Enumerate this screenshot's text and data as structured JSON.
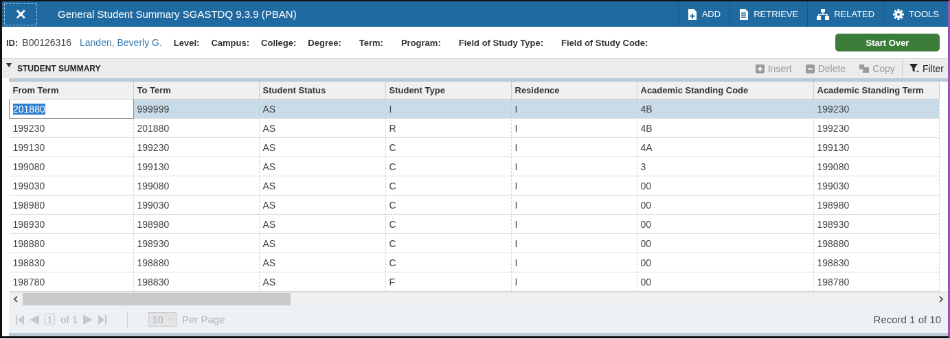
{
  "window": {
    "close": "✕",
    "title": "General Student Summary SGASTDQ 9.3.9 (PBAN)"
  },
  "toolbar": [
    {
      "label": "ADD",
      "kind": "add"
    },
    {
      "label": "RETRIEVE",
      "kind": "retrieve"
    },
    {
      "label": "RELATED",
      "kind": "related"
    },
    {
      "label": "TOOLS",
      "kind": "tools"
    }
  ],
  "key_block": {
    "id_label": "ID:",
    "id": "B00126316",
    "name": "Landen, Beverly G.",
    "fields": [
      "Level:",
      "Campus:",
      "College:",
      "Degree:",
      "Term:",
      "Program:",
      "Field of Study Type:",
      "Field of Study Code:"
    ],
    "start_over": "Start Over"
  },
  "section": {
    "title": "STUDENT SUMMARY",
    "expanded": true,
    "actions": [
      {
        "label": "Insert",
        "kind": "insert",
        "disabled": true
      },
      {
        "label": "Delete",
        "kind": "delete",
        "disabled": true
      },
      {
        "label": "Copy",
        "kind": "copy",
        "disabled": true
      },
      {
        "label": "Filter",
        "kind": "filter",
        "disabled": false
      }
    ]
  },
  "table": {
    "columns": [
      "From Term",
      "To Term",
      "Student Status",
      "Student Type",
      "Residence",
      "Academic Standing Code",
      "Academic Standing Term"
    ],
    "rows": [
      {
        "selected": true,
        "cells": [
          "201880",
          "999999",
          "AS",
          "I",
          "I",
          "4B",
          "199230"
        ]
      },
      {
        "selected": false,
        "cells": [
          "199230",
          "201880",
          "AS",
          "R",
          "I",
          "4B",
          "199230"
        ]
      },
      {
        "selected": false,
        "cells": [
          "199130",
          "199230",
          "AS",
          "C",
          "I",
          "4A",
          "199130"
        ]
      },
      {
        "selected": false,
        "cells": [
          "199080",
          "199130",
          "AS",
          "C",
          "I",
          "3",
          "199080"
        ]
      },
      {
        "selected": false,
        "cells": [
          "199030",
          "199080",
          "AS",
          "C",
          "I",
          "00",
          "199030"
        ]
      },
      {
        "selected": false,
        "cells": [
          "198980",
          "199030",
          "AS",
          "C",
          "I",
          "00",
          "198980"
        ]
      },
      {
        "selected": false,
        "cells": [
          "198930",
          "198980",
          "AS",
          "C",
          "I",
          "00",
          "198930"
        ]
      },
      {
        "selected": false,
        "cells": [
          "198880",
          "198930",
          "AS",
          "C",
          "I",
          "00",
          "198880"
        ]
      },
      {
        "selected": false,
        "cells": [
          "198830",
          "198880",
          "AS",
          "C",
          "I",
          "00",
          "198830"
        ]
      },
      {
        "selected": false,
        "cells": [
          "198780",
          "198830",
          "AS",
          "F",
          "I",
          "00",
          "198780"
        ]
      }
    ]
  },
  "pager": {
    "page": "1",
    "of": "of 1",
    "per_page": "10",
    "per_page_label": "Per Page",
    "record": "Record 1 of 10"
  }
}
